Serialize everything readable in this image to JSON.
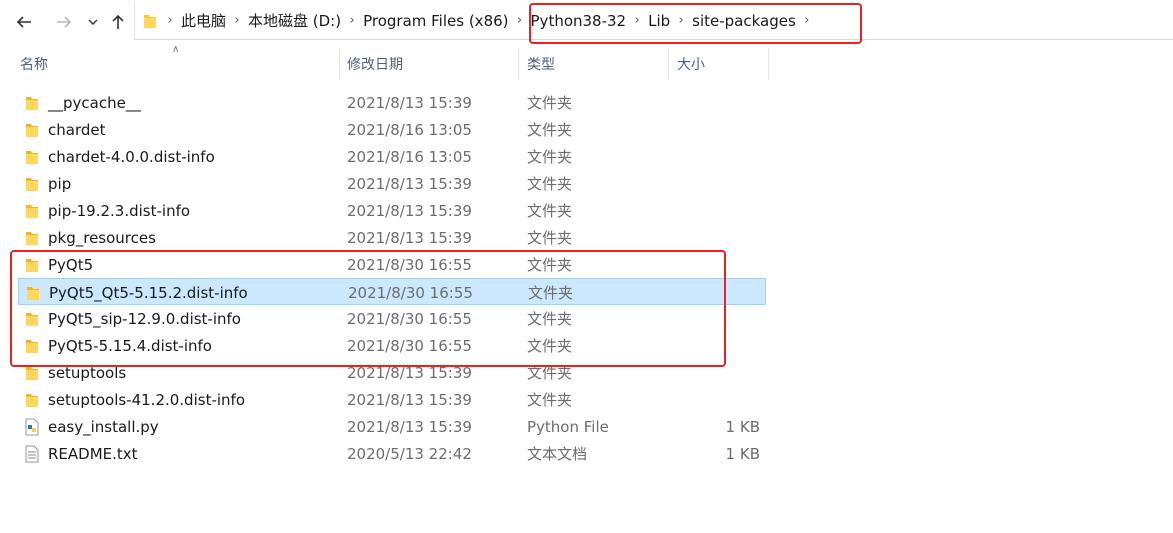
{
  "navigation": {
    "back_icon": "arrow-left-icon",
    "forward_icon": "arrow-right-icon",
    "recent_icon": "chevron-down-icon",
    "up_icon": "arrow-up-icon"
  },
  "breadcrumb": [
    {
      "label": "此电脑"
    },
    {
      "label": "本地磁盘 (D:)"
    },
    {
      "label": "Program Files (x86)"
    },
    {
      "label": "Python38-32"
    },
    {
      "label": "Lib"
    },
    {
      "label": "site-packages"
    }
  ],
  "columns": {
    "name": "名称",
    "date": "修改日期",
    "type": "类型",
    "size": "大小"
  },
  "files": [
    {
      "name": "__pycache__",
      "date": "2021/8/13 15:39",
      "type": "文件夹",
      "size": "",
      "icon": "folder-icon"
    },
    {
      "name": "chardet",
      "date": "2021/8/16 13:05",
      "type": "文件夹",
      "size": "",
      "icon": "folder-icon"
    },
    {
      "name": "chardet-4.0.0.dist-info",
      "date": "2021/8/16 13:05",
      "type": "文件夹",
      "size": "",
      "icon": "folder-icon"
    },
    {
      "name": "pip",
      "date": "2021/8/13 15:39",
      "type": "文件夹",
      "size": "",
      "icon": "folder-icon"
    },
    {
      "name": "pip-19.2.3.dist-info",
      "date": "2021/8/13 15:39",
      "type": "文件夹",
      "size": "",
      "icon": "folder-icon"
    },
    {
      "name": "pkg_resources",
      "date": "2021/8/13 15:39",
      "type": "文件夹",
      "size": "",
      "icon": "folder-icon"
    },
    {
      "name": "PyQt5",
      "date": "2021/8/30 16:55",
      "type": "文件夹",
      "size": "",
      "icon": "folder-icon"
    },
    {
      "name": "PyQt5_Qt5-5.15.2.dist-info",
      "date": "2021/8/30 16:55",
      "type": "文件夹",
      "size": "",
      "icon": "folder-icon",
      "selected": true
    },
    {
      "name": "PyQt5_sip-12.9.0.dist-info",
      "date": "2021/8/30 16:55",
      "type": "文件夹",
      "size": "",
      "icon": "folder-icon"
    },
    {
      "name": "PyQt5-5.15.4.dist-info",
      "date": "2021/8/30 16:55",
      "type": "文件夹",
      "size": "",
      "icon": "folder-icon"
    },
    {
      "name": "setuptools",
      "date": "2021/8/13 15:39",
      "type": "文件夹",
      "size": "",
      "icon": "folder-icon"
    },
    {
      "name": "setuptools-41.2.0.dist-info",
      "date": "2021/8/13 15:39",
      "type": "文件夹",
      "size": "",
      "icon": "folder-icon"
    },
    {
      "name": "easy_install.py",
      "date": "2021/8/13 15:39",
      "type": "Python File",
      "size": "1 KB",
      "icon": "python-file-icon"
    },
    {
      "name": "README.txt",
      "date": "2020/5/13 22:42",
      "type": "文本文档",
      "size": "1 KB",
      "icon": "text-file-icon"
    }
  ],
  "colors": {
    "selection_bg": "#cce8ff",
    "selection_border": "#99d1ff",
    "annotation_red": "#ee2020",
    "folder_yellow": "#f8c93e",
    "header_text": "#4d6082"
  }
}
